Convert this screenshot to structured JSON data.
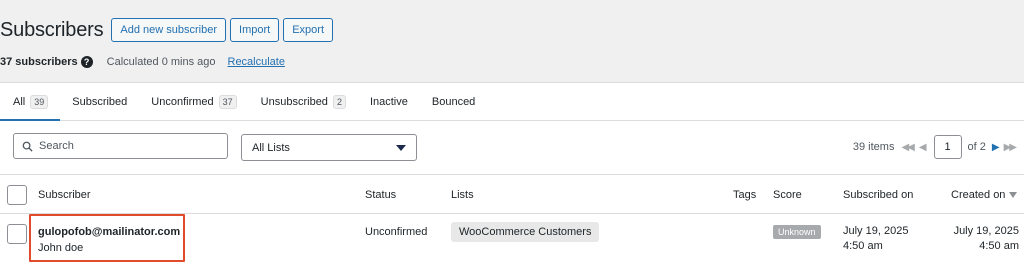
{
  "header": {
    "title": "Subscribers",
    "buttons": {
      "add": "Add new subscriber",
      "import": "Import",
      "export": "Export"
    }
  },
  "summary": {
    "count": "37 subscribers",
    "calculated": "Calculated 0 mins ago",
    "recalculate": "Recalculate"
  },
  "tabs": [
    {
      "label": "All",
      "count": "39"
    },
    {
      "label": "Subscribed",
      "count": ""
    },
    {
      "label": "Unconfirmed",
      "count": "37"
    },
    {
      "label": "Unsubscribed",
      "count": "2"
    },
    {
      "label": "Inactive",
      "count": ""
    },
    {
      "label": "Bounced",
      "count": ""
    }
  ],
  "filters": {
    "search_placeholder": "Search",
    "list_selected": "All Lists"
  },
  "pagination": {
    "items": "39 items",
    "page": "1",
    "of": "of 2"
  },
  "columns": {
    "subscriber": "Subscriber",
    "status": "Status",
    "lists": "Lists",
    "tags": "Tags",
    "score": "Score",
    "subscribed_on": "Subscribed on",
    "created_on": "Created on"
  },
  "rows": [
    {
      "email": "gulopofob@mailinator.com",
      "name": "John doe",
      "status": "Unconfirmed",
      "list": "WooCommerce Customers",
      "score": "Unknown",
      "subscribed_date": "July 19, 2025",
      "subscribed_time": "4:50 am",
      "created_date": "July 19, 2025",
      "created_time": "4:50 am"
    }
  ],
  "colors": {
    "accent": "#2271b1",
    "highlight": "#e04b2b",
    "background": "#f0f0f1"
  }
}
